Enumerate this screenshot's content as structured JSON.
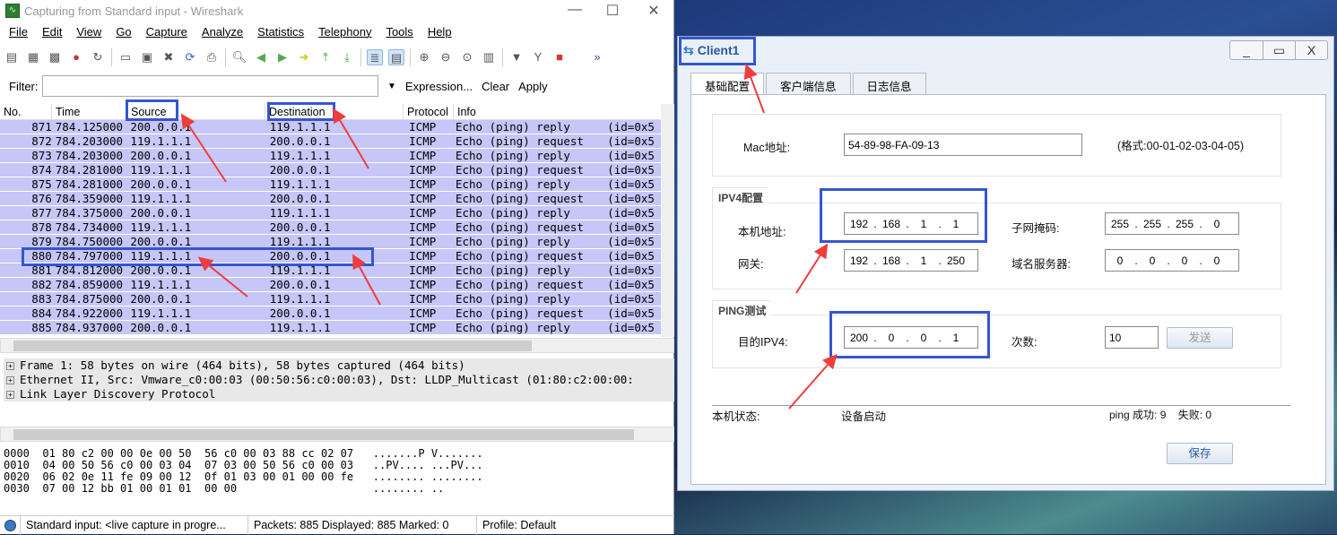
{
  "wireshark": {
    "title": "Capturing from Standard input - Wireshark",
    "menu": [
      "File",
      "Edit",
      "View",
      "Go",
      "Capture",
      "Analyze",
      "Statistics",
      "Telephony",
      "Tools",
      "Help"
    ],
    "filter": {
      "label": "Filter:",
      "value": "",
      "expression": "Expression...",
      "clear": "Clear",
      "apply": "Apply"
    },
    "columns": [
      "No.",
      "Time",
      "Source",
      "Destination",
      "Protocol",
      "Info"
    ],
    "row_color": "#c6c6f8",
    "packets": [
      [
        "871",
        "784.125000",
        "200.0.0.1",
        "119.1.1.1",
        "ICMP",
        "Echo (ping) reply",
        "(id=0x5"
      ],
      [
        "872",
        "784.203000",
        "119.1.1.1",
        "200.0.0.1",
        "ICMP",
        "Echo (ping) request",
        "(id=0x5"
      ],
      [
        "873",
        "784.203000",
        "200.0.0.1",
        "119.1.1.1",
        "ICMP",
        "Echo (ping) reply",
        "(id=0x5"
      ],
      [
        "874",
        "784.281000",
        "119.1.1.1",
        "200.0.0.1",
        "ICMP",
        "Echo (ping) request",
        "(id=0x5"
      ],
      [
        "875",
        "784.281000",
        "200.0.0.1",
        "119.1.1.1",
        "ICMP",
        "Echo (ping) reply",
        "(id=0x5"
      ],
      [
        "876",
        "784.359000",
        "119.1.1.1",
        "200.0.0.1",
        "ICMP",
        "Echo (ping) request",
        "(id=0x5"
      ],
      [
        "877",
        "784.375000",
        "200.0.0.1",
        "119.1.1.1",
        "ICMP",
        "Echo (ping) reply",
        "(id=0x5"
      ],
      [
        "878",
        "784.734000",
        "119.1.1.1",
        "200.0.0.1",
        "ICMP",
        "Echo (ping) request",
        "(id=0x5"
      ],
      [
        "879",
        "784.750000",
        "200.0.0.1",
        "119.1.1.1",
        "ICMP",
        "Echo (ping) reply",
        "(id=0x5"
      ],
      [
        "880",
        "784.797000",
        "119.1.1.1",
        "200.0.0.1",
        "ICMP",
        "Echo (ping) request",
        "(id=0x5"
      ],
      [
        "881",
        "784.812000",
        "200.0.0.1",
        "119.1.1.1",
        "ICMP",
        "Echo (ping) reply",
        "(id=0x5"
      ],
      [
        "882",
        "784.859000",
        "119.1.1.1",
        "200.0.0.1",
        "ICMP",
        "Echo (ping) request",
        "(id=0x5"
      ],
      [
        "883",
        "784.875000",
        "200.0.0.1",
        "119.1.1.1",
        "ICMP",
        "Echo (ping) reply",
        "(id=0x5"
      ],
      [
        "884",
        "784.922000",
        "119.1.1.1",
        "200.0.0.1",
        "ICMP",
        "Echo (ping) request",
        "(id=0x5"
      ],
      [
        "885",
        "784.937000",
        "200.0.0.1",
        "119.1.1.1",
        "ICMP",
        "Echo (ping) reply",
        "(id=0x5"
      ]
    ],
    "details": [
      "Frame 1: 58 bytes on wire (464 bits), 58 bytes captured (464 bits)",
      "Ethernet II, Src: Vmware_c0:00:03 (00:50:56:c0:00:03), Dst: LLDP_Multicast (01:80:c2:00:00:",
      "Link Layer Discovery Protocol"
    ],
    "hex": [
      "0000  01 80 c2 00 00 0e 00 50  56 c0 00 03 88 cc 02 07   .......P V.......",
      "0010  04 00 50 56 c0 00 03 04  07 03 00 50 56 c0 00 03   ..PV.... ...PV...",
      "0020  06 02 0e 11 fe 09 00 12  0f 01 03 00 01 00 00 fe   ........ ........",
      "0030  07 00 12 bb 01 00 01 01  00 00                     ........ .."
    ],
    "status": {
      "capture": "Standard input: <live capture in progre...",
      "packets": "Packets: 885 Displayed: 885 Marked: 0",
      "profile": "Profile: Default"
    }
  },
  "client": {
    "title": "Client1",
    "tabs": [
      "基础配置",
      "客户端信息",
      "日志信息"
    ],
    "mac_label": "Mac地址:",
    "mac_value": "54-89-98-FA-09-13",
    "mac_hint": "(格式:00-01-02-03-04-05)",
    "ipv4_group": "IPV4配置",
    "ip_label": "本机地址:",
    "ip": [
      "192",
      "168",
      "1",
      "1"
    ],
    "mask_label": "子网掩码:",
    "mask": [
      "255",
      "255",
      "255",
      "0"
    ],
    "gw_label": "网关:",
    "gw": [
      "192",
      "168",
      "1",
      "250"
    ],
    "dns_label": "域名服务器:",
    "dns": [
      "0",
      "0",
      "0",
      "0"
    ],
    "ping_group": "PING测试",
    "dst_label": "目的IPV4:",
    "dst": [
      "200",
      "0",
      "0",
      "1"
    ],
    "count_label": "次数:",
    "count": "10",
    "send": "发送",
    "state_label": "本机状态:",
    "state": "设备启动",
    "ping_result": "ping 成功: 9    失败: 0",
    "save": "保存"
  },
  "annotation_color": "#3556d0",
  "arrow_color": "#f03c3c"
}
